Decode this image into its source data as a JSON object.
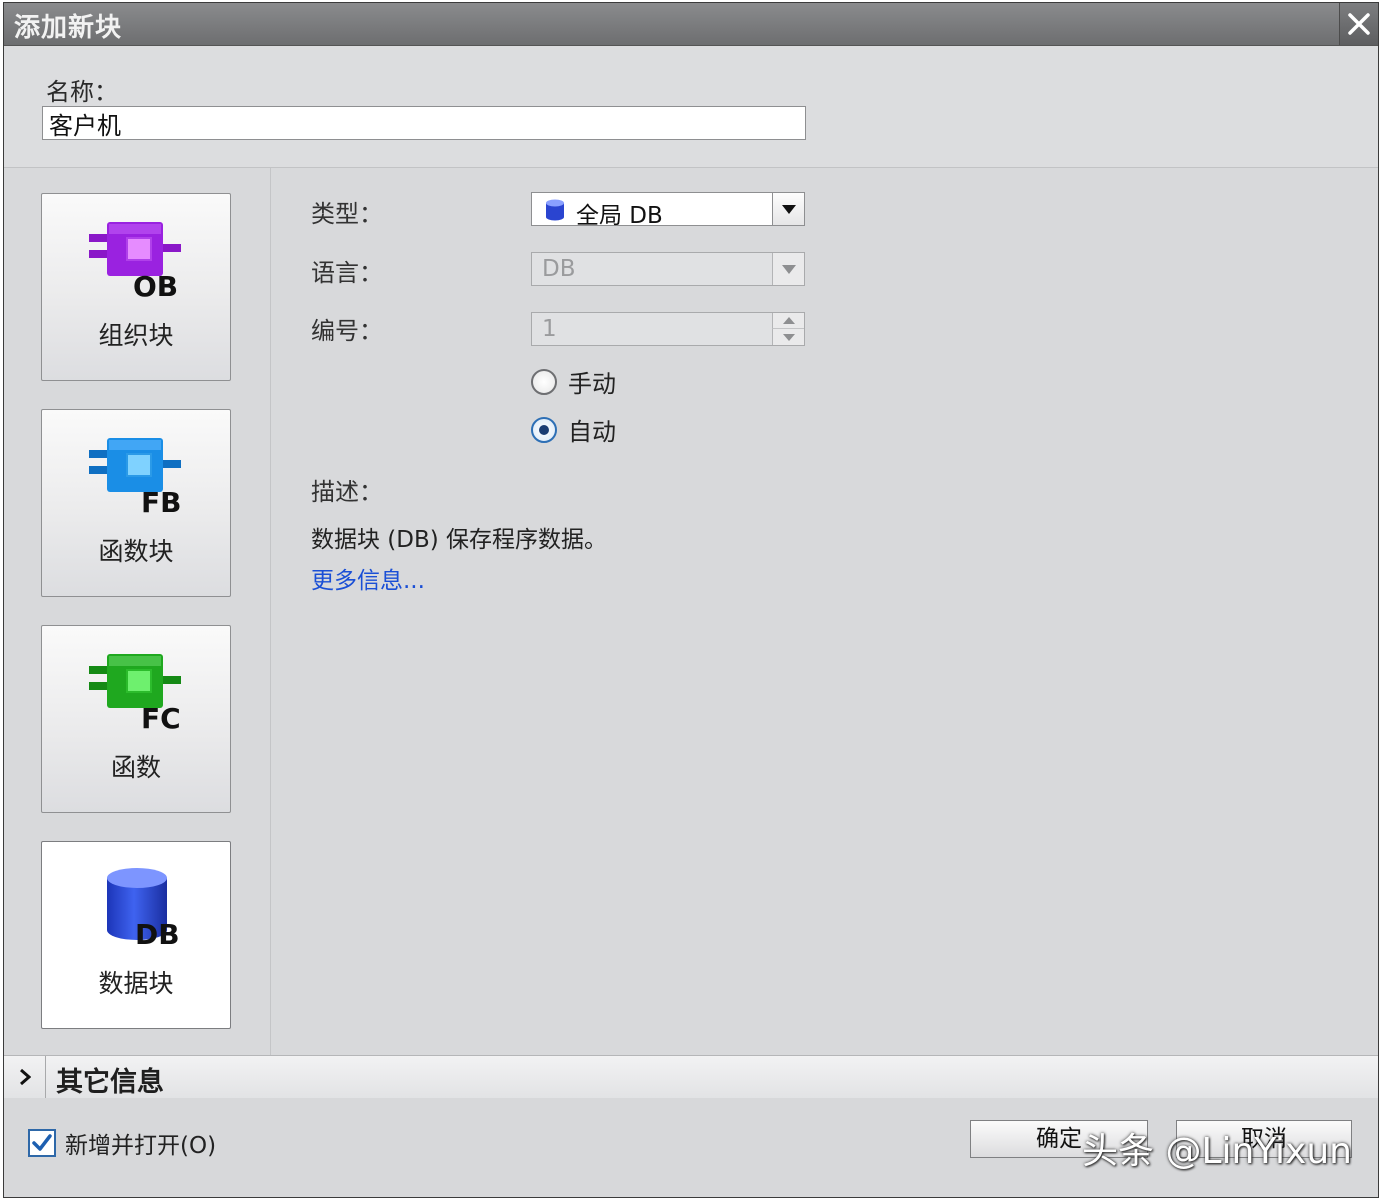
{
  "window": {
    "title": "添加新块"
  },
  "name_field": {
    "label": "名称：",
    "value": "客户机"
  },
  "block_types": [
    {
      "id": "OB",
      "label": "组织块",
      "icon": "ob-block-icon",
      "color": "#a020e8",
      "selected": false
    },
    {
      "id": "FB",
      "label": "函数块",
      "icon": "fb-block-icon",
      "color": "#1a8ee6",
      "selected": false
    },
    {
      "id": "FC",
      "label": "函数",
      "icon": "fc-block-icon",
      "color": "#1fa81f",
      "selected": false
    },
    {
      "id": "DB",
      "label": "数据块",
      "icon": "db-block-icon",
      "color": "#2546d6",
      "selected": true
    }
  ],
  "properties": {
    "type_label": "类型：",
    "type_value": "全局 DB",
    "language_label": "语言：",
    "language_value": "DB",
    "number_label": "编号：",
    "number_value": "1",
    "radio_manual": "手动",
    "radio_auto": "自动",
    "radio_selected": "自动",
    "description_label": "描述：",
    "description_text": "数据块 (DB) 保存程序数据。",
    "more_info_link": "更多信息..."
  },
  "other_info": {
    "label": "其它信息"
  },
  "footer": {
    "add_open_label": "新增并打开(O)",
    "add_open_checked": true,
    "ok_label": "确定",
    "cancel_label": "取消"
  },
  "watermark": "头条 @LinYixun"
}
